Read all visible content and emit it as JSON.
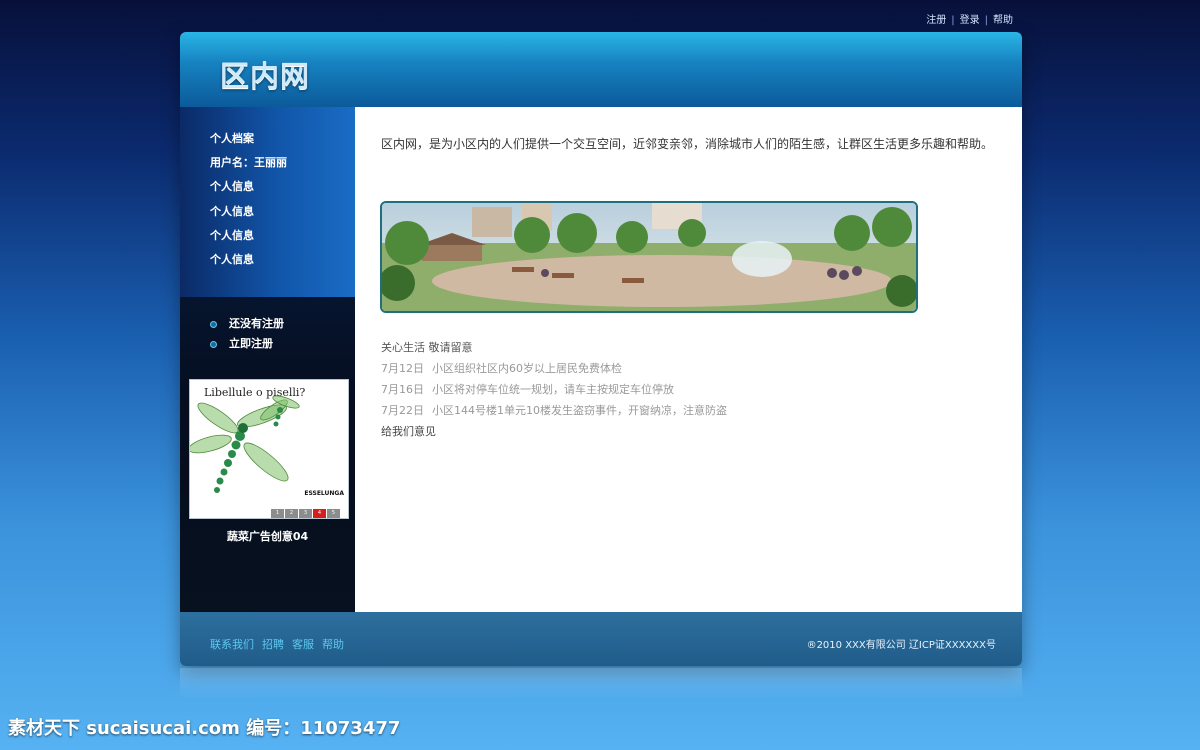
{
  "top_links": [
    "注册",
    "登录",
    "帮助"
  ],
  "logo": "区内网",
  "sidebar": {
    "nav_items": [
      "个人档案",
      "用户名：王丽丽",
      "个人信息",
      "个人信息",
      "个人信息",
      "个人信息"
    ],
    "register_items": [
      "还没有注册",
      "立即注册"
    ],
    "ad": {
      "title_text": "Libellule o piselli?",
      "brand_text": "ESSELUNGA",
      "pager": [
        "1",
        "2",
        "3",
        "4",
        "5"
      ],
      "active_page": 4,
      "caption": "蔬菜广告创意04"
    }
  },
  "content": {
    "intro": "区内网，是为小区内的人们提供一个交互空间，近邻变亲邻，消除城市人们的陌生感，让群区生活更多乐趣和帮助。",
    "news_title": "关心生活  敬请留意",
    "news": [
      {
        "date": "7月12日",
        "text": "小区组织社区内60岁以上居民免费体检"
      },
      {
        "date": "7月16日",
        "text": "小区将对停车位统一规划，请车主按规定车位停放"
      },
      {
        "date": "7月22日",
        "text": "小区144号楼1单元10楼发生盗窃事件，开窗纳凉，注意防盗"
      }
    ],
    "feedback": "给我们意见"
  },
  "footer": {
    "links": [
      "联系我们",
      "招聘",
      "客服",
      "帮助"
    ],
    "copyright": "®2010  XXX有限公司  辽ICP证XXXXXX号"
  },
  "watermark": "素材天下 sucaisucai.com  编号：11073477"
}
